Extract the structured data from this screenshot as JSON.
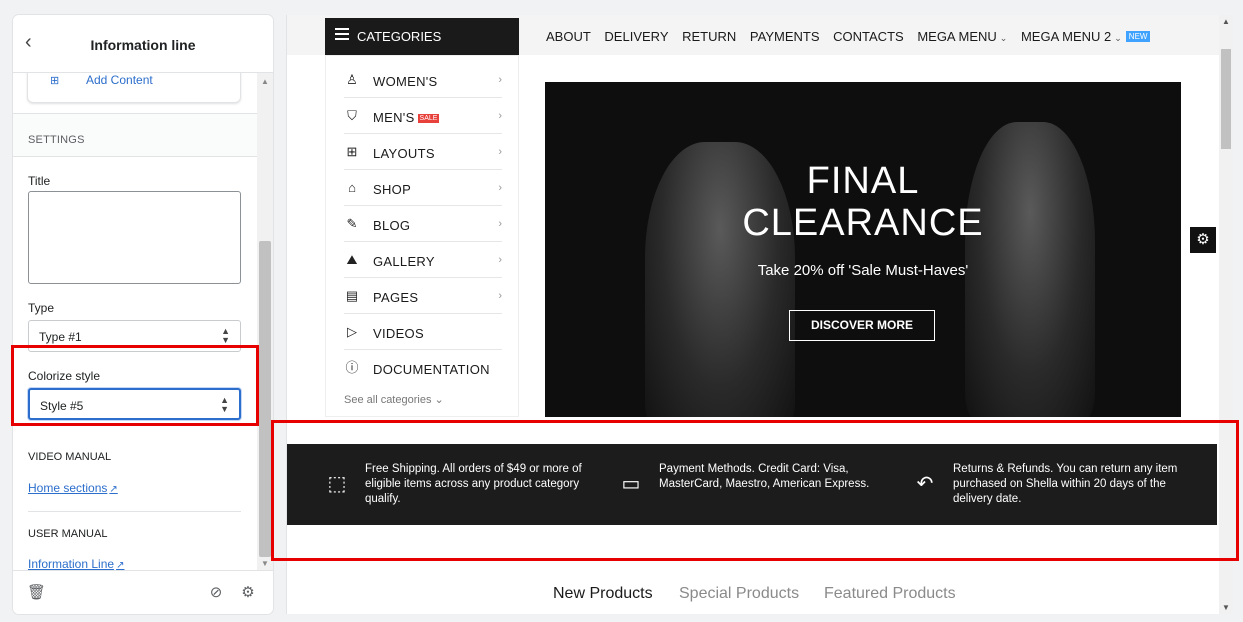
{
  "editor": {
    "back_icon": "chevron-left-icon",
    "title": "Information line",
    "add_content_label": "Add Content",
    "settings_header": "SETTINGS",
    "title_field": {
      "label": "Title",
      "value": ""
    },
    "type_field": {
      "label": "Type",
      "value": "Type #1"
    },
    "colorize_field": {
      "label": "Colorize style",
      "value": "Style #5"
    },
    "video_manual": {
      "header": "VIDEO MANUAL",
      "link": "Home sections"
    },
    "user_manual": {
      "header": "USER MANUAL",
      "link": "Information Line"
    },
    "footer_icons": [
      "trash-icon",
      "eye-off-icon",
      "gear-icon"
    ]
  },
  "preview": {
    "categories_label": "CATEGORIES",
    "nav": [
      "ABOUT",
      "DELIVERY",
      "RETURN",
      "PAYMENTS",
      "CONTACTS",
      "MEGA MENU",
      "MEGA MENU 2"
    ],
    "nav_badge": "NEW",
    "category_items": [
      {
        "label": "WOMEN'S",
        "icon": "dress-icon"
      },
      {
        "label": "MEN'S",
        "icon": "shirt-icon",
        "badge": "SALE"
      },
      {
        "label": "LAYOUTS",
        "icon": "grid-icon"
      },
      {
        "label": "SHOP",
        "icon": "store-icon"
      },
      {
        "label": "BLOG",
        "icon": "edit-icon"
      },
      {
        "label": "GALLERY",
        "icon": "mountain-icon"
      },
      {
        "label": "PAGES",
        "icon": "id-card-icon"
      },
      {
        "label": "VIDEOS",
        "icon": "play-icon"
      },
      {
        "label": "DOCUMENTATION",
        "icon": "info-icon"
      }
    ],
    "see_all": "See all categories",
    "hero": {
      "line1": "FINAL",
      "line2": "CLEARANCE",
      "subtitle": "Take 20% off 'Sale Must-Haves'",
      "button": "DISCOVER MORE"
    },
    "info_line": [
      {
        "icon": "box-icon",
        "text": "Free Shipping. All orders of $49 or more of eligible items across any product category qualify."
      },
      {
        "icon": "credit-card-icon",
        "text": "Payment Methods. Credit Card: Visa, MasterCard, Maestro, American Express."
      },
      {
        "icon": "return-arrow-icon",
        "text": "Returns & Refunds. You can return any item purchased on Shella within 20 days of the delivery date."
      }
    ],
    "product_tabs": [
      "New Products",
      "Special Products",
      "Featured Products"
    ],
    "colors": {
      "highlight": "#e60000",
      "link": "#2c6ecb",
      "info_bar": "#1c1c1c",
      "badge_new": "#3fa2ff",
      "badge_sale": "#e8413b"
    }
  }
}
